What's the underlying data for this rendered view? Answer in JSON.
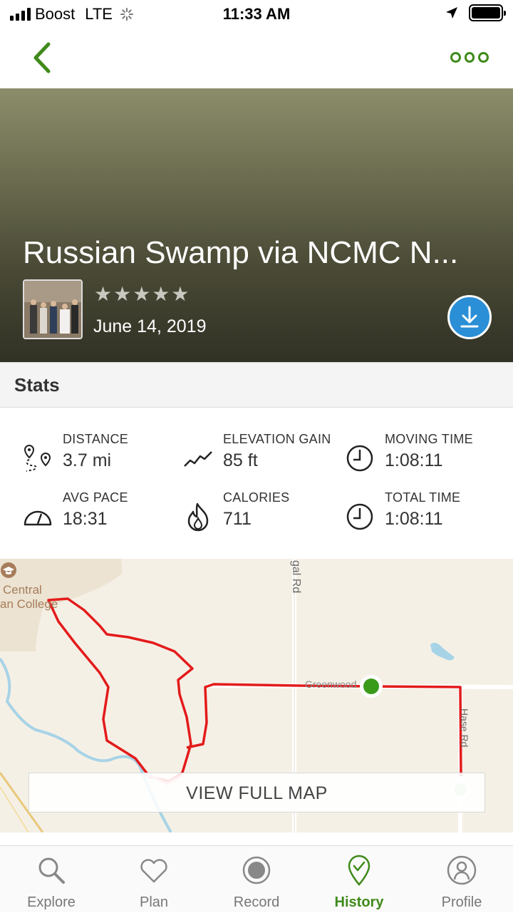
{
  "status_bar": {
    "carrier": "Boost",
    "network": "LTE",
    "time": "11:33 AM"
  },
  "nav": {
    "back_icon": "chevron-left-icon",
    "more_icon": "more-dots-icon",
    "accent_color": "#3f8a1a"
  },
  "activity": {
    "title": "Russian Swamp via NCMC N...",
    "rating_stars": "★★★★★",
    "date": "June 14, 2019"
  },
  "stats": {
    "header": "Stats",
    "items": [
      {
        "label": "DISTANCE",
        "value": "3.7 mi",
        "icon": "route-pins-icon"
      },
      {
        "label": "ELEVATION GAIN",
        "value": "85 ft",
        "icon": "elevation-icon"
      },
      {
        "label": "MOVING TIME",
        "value": "1:08:11",
        "icon": "clock-icon"
      },
      {
        "label": "AVG PACE",
        "value": "18:31",
        "icon": "speedometer-icon"
      },
      {
        "label": "CALORIES",
        "value": "711",
        "icon": "flame-icon"
      },
      {
        "label": "TOTAL TIME",
        "value": "1:08:11",
        "icon": "clock-icon"
      }
    ]
  },
  "map": {
    "labels": {
      "college_1": "Central",
      "college_2": "an College",
      "road_vertical": "gal Rd",
      "road_greenwood": "Greenwood",
      "road_hase": "Hase Rd"
    },
    "view_full_map": "VIEW FULL MAP",
    "route_color": "#e31b1b"
  },
  "tabs": [
    {
      "label": "Explore",
      "icon": "search-icon",
      "active": false
    },
    {
      "label": "Plan",
      "icon": "heart-icon",
      "active": false
    },
    {
      "label": "Record",
      "icon": "record-icon",
      "active": false
    },
    {
      "label": "History",
      "icon": "location-check-icon",
      "active": true
    },
    {
      "label": "Profile",
      "icon": "profile-icon",
      "active": false
    }
  ]
}
